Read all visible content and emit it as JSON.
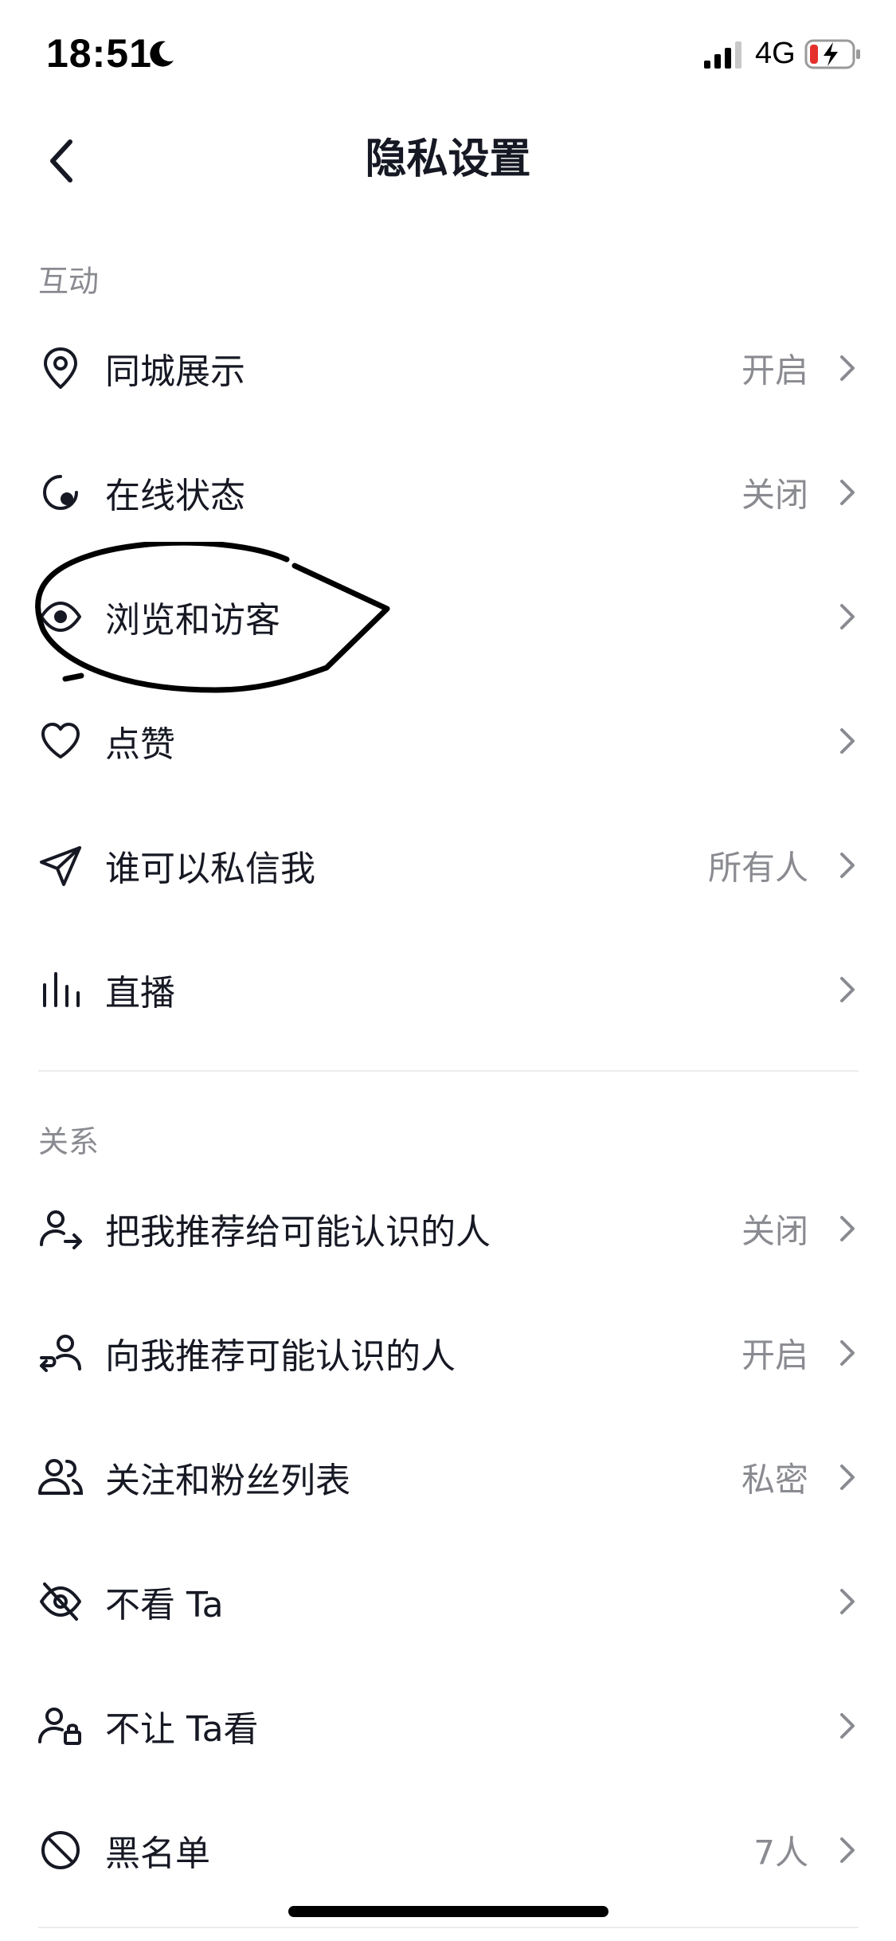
{
  "status_bar": {
    "time": "18:51",
    "network": "4G",
    "icons": [
      "moon-icon",
      "signal-icon",
      "battery-charging-icon"
    ]
  },
  "header": {
    "title": "隐私设置",
    "back_icon": "back-arrow-icon"
  },
  "sections": [
    {
      "title": "互动",
      "items": [
        {
          "label": "同城展示",
          "value": "开启",
          "icon": "location-pin-icon"
        },
        {
          "label": "在线状态",
          "value": "关闭",
          "icon": "online-status-icon"
        },
        {
          "label": "浏览和访客",
          "value": "",
          "icon": "eye-icon"
        },
        {
          "label": "点赞",
          "value": "",
          "icon": "heart-icon"
        },
        {
          "label": "谁可以私信我",
          "value": "所有人",
          "icon": "send-icon"
        },
        {
          "label": "直播",
          "value": "",
          "icon": "live-bars-icon"
        }
      ]
    },
    {
      "title": "关系",
      "items": [
        {
          "label": "把我推荐给可能认识的人",
          "value": "关闭",
          "icon": "user-share-icon"
        },
        {
          "label": "向我推荐可能认识的人",
          "value": "开启",
          "icon": "user-recommend-icon"
        },
        {
          "label": "关注和粉丝列表",
          "value": "私密",
          "icon": "users-icon"
        },
        {
          "label": "不看 Ta",
          "value": "",
          "icon": "eye-off-icon"
        },
        {
          "label": "不让 Ta看",
          "value": "",
          "icon": "user-lock-icon"
        },
        {
          "label": "黑名单",
          "value": "7人",
          "icon": "block-icon"
        }
      ]
    }
  ],
  "colors": {
    "text_primary": "#161823",
    "text_secondary": "#8a8b91",
    "divider": "#ececee",
    "annotation": "#000000"
  }
}
